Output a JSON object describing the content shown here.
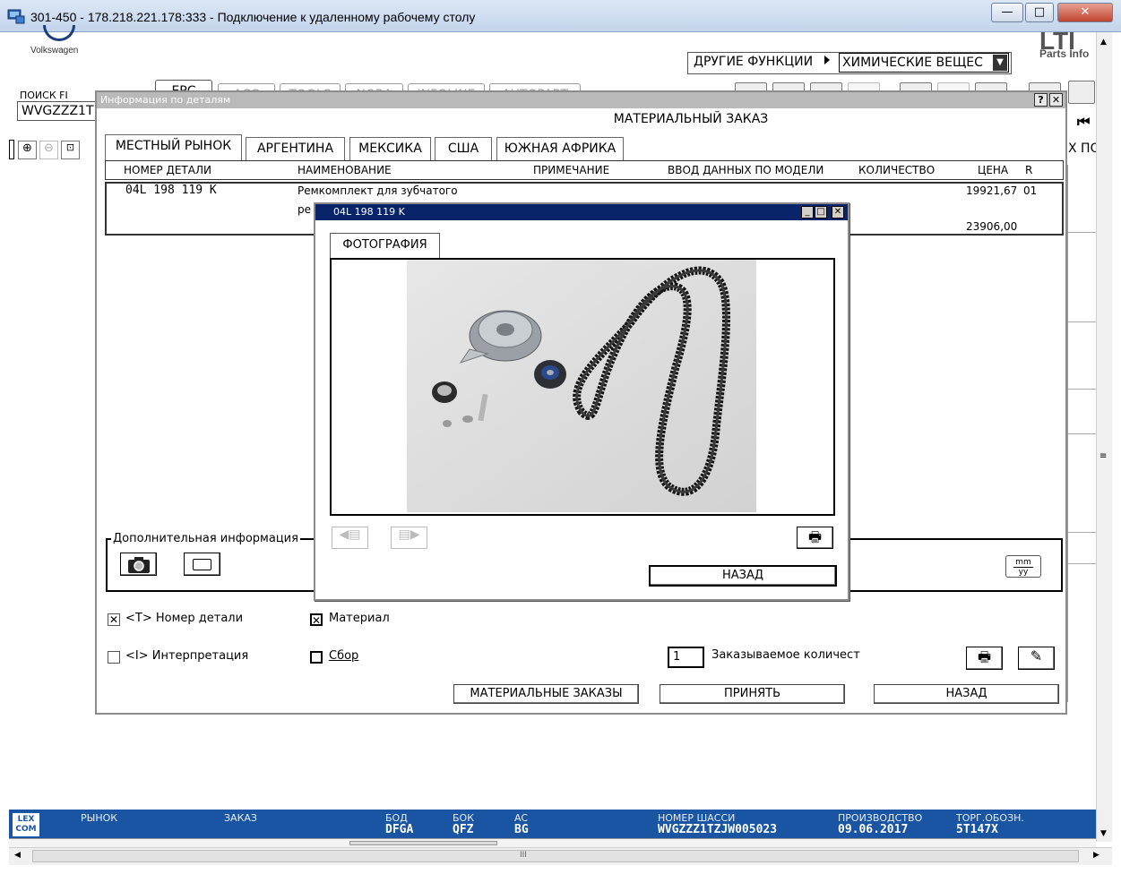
{
  "window": {
    "title": "301-450 - 178.218.221.178:333 - Подключение к удаленному рабочему столу",
    "minimize": "—",
    "maximize": "□",
    "close": "✕"
  },
  "brand": {
    "name": "Volkswagen",
    "right_brand": "Parts Info",
    "right_logo": "LTI"
  },
  "top_tabs": [
    {
      "label": "EPC",
      "active": true
    },
    {
      "label": "ACC"
    },
    {
      "label": "TOOLS"
    },
    {
      "label": "NORA"
    },
    {
      "label": "INFOLINE"
    },
    {
      "label": "AUTOPART"
    }
  ],
  "other_functions": {
    "label": "ДРУГИЕ ФУНКЦИИ",
    "select_value": "ХИМИЧЕСКИЕ ВЕЩЕС"
  },
  "search": {
    "label": "ПОИСК FI",
    "value": "WVGZZZ1T"
  },
  "right_edge_text": "Х ПО",
  "dialog": {
    "title": "Информация по деталям",
    "help": "?",
    "close": "✕",
    "heading": "МАТЕРИАЛЬНЫЙ ЗАКАЗ",
    "market_tabs": [
      {
        "label": "МЕСТНЫЙ РЫНОК",
        "active": true
      },
      {
        "label": "АРГЕНТИНА"
      },
      {
        "label": "МЕКСИКА"
      },
      {
        "label": "США"
      },
      {
        "label": "ЮЖНАЯ АФРИКА"
      }
    ],
    "columns": {
      "part_no": "НОМЕР ДЕТАЛИ",
      "name": "НАИМЕНОВАНИЕ",
      "note": "ПРИМЕЧАНИЕ",
      "model": "ВВОД ДАННЫХ ПО МОДЕЛИ",
      "qty": "КОЛИЧЕСТВО",
      "price": "ЦЕНА",
      "r": "R"
    },
    "row": {
      "part_no": "04L 198 119 K",
      "name_line1": "Ремкомплект для зубчатого",
      "name_line2": "ре",
      "price1": "19921,67",
      "r": "01",
      "price2": "23906,00"
    },
    "additional_info": "Дополнительная информация",
    "mm_yy": {
      "top": "mm",
      "bottom": "yy"
    },
    "checks": {
      "part_number": {
        "label": "<T> Номер детали",
        "checked": true
      },
      "material": {
        "label": "Материал",
        "checked": true
      },
      "interpretation": {
        "label": "<I> Интерпретация",
        "checked": false
      },
      "assembly": {
        "label": "Сбор",
        "checked": false
      }
    },
    "order_qty": {
      "value": "1",
      "label": "Заказываемое количест"
    },
    "buttons": {
      "material_orders": "МАТЕРИАЛЬНЫЕ ЗАКАЗЫ",
      "accept": "ПРИНЯТЬ",
      "back": "НАЗАД"
    }
  },
  "photo_popup": {
    "title": "04L 198 119 K",
    "tab": "ФОТОГРАФИЯ",
    "back_button": "НАЗАД",
    "image_alt": "timing belt kit"
  },
  "status_bar": {
    "logo": "LEX COM",
    "fields": [
      {
        "label": "РЫНОК",
        "value": ""
      },
      {
        "label": "ЗАКАЗ",
        "value": ""
      },
      {
        "label": "БОД",
        "value": "DFGA"
      },
      {
        "label": "БОК",
        "value": "QFZ"
      },
      {
        "label": "AC",
        "value": "BG"
      },
      {
        "label": "НОМЕР ШАССИ",
        "value": "WVGZZZ1TZJW005023"
      },
      {
        "label": "ПРОИЗВОДСТВО",
        "value": "09.06.2017"
      },
      {
        "label": "ТОРГ.ОБОЗН.",
        "value": "5T147X"
      }
    ]
  },
  "colors": {
    "status_bar": "#1a55a3",
    "popup_title": "#0a246a",
    "dialog_title": "#b9b9b9"
  }
}
